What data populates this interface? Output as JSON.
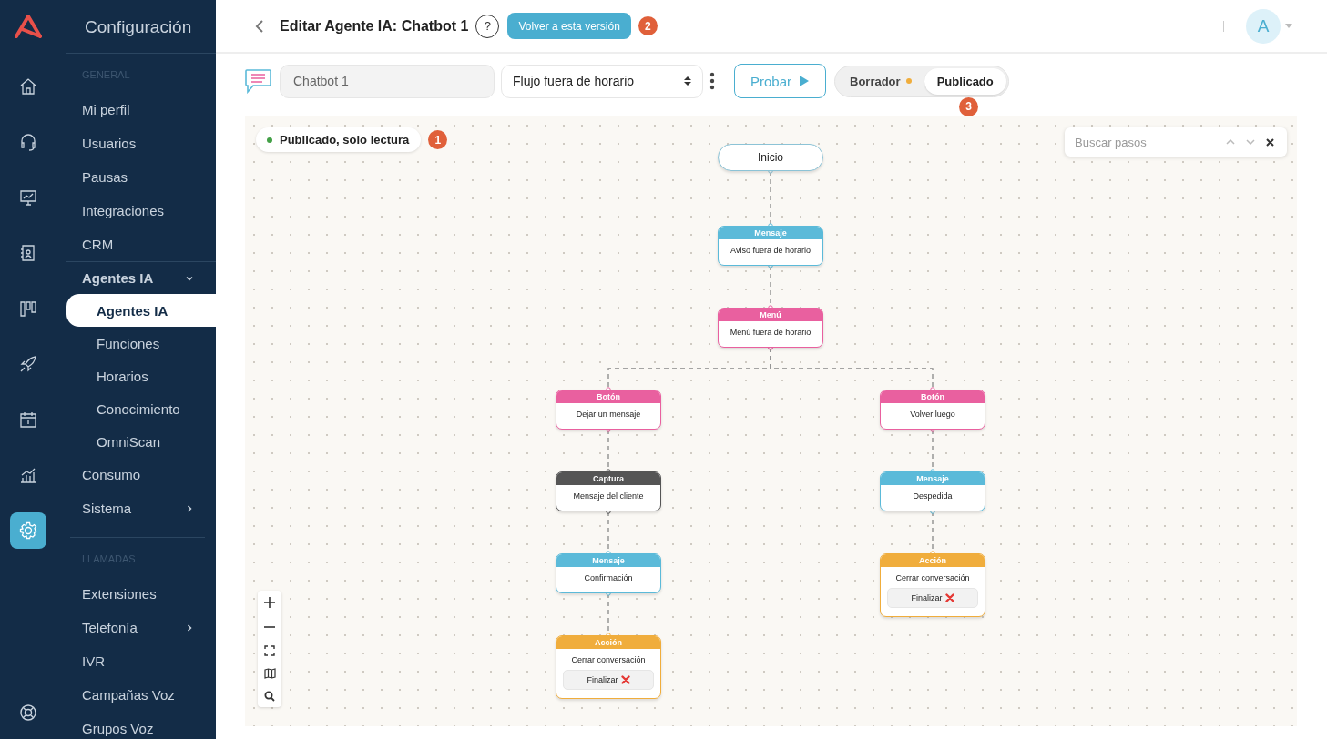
{
  "rail": [
    {
      "kind": "home",
      "selected": false
    },
    {
      "kind": "headset",
      "selected": false
    },
    {
      "kind": "monitor",
      "selected": false
    },
    {
      "kind": "contacts",
      "selected": false
    },
    {
      "kind": "board",
      "selected": false
    },
    {
      "kind": "rocket",
      "selected": false
    },
    {
      "kind": "calendar",
      "selected": false
    },
    {
      "kind": "chart",
      "selected": false
    },
    {
      "kind": "settings",
      "selected": true
    }
  ],
  "sidebar": {
    "title": "Configuración",
    "sections": [
      {
        "heading": "GENERAL",
        "items": [
          {
            "label": "Mi perfil",
            "selected": false
          },
          {
            "label": "Usuarios",
            "selected": false
          },
          {
            "label": "Pausas",
            "selected": false
          },
          {
            "label": "Integraciones",
            "selected": false
          },
          {
            "label": "CRM",
            "selected": false
          },
          {
            "label": "Agentes IA",
            "selected": false,
            "expanded": true,
            "children": [
              {
                "label": "Agentes IA",
                "selected": true
              },
              {
                "label": "Funciones",
                "selected": false
              },
              {
                "label": "Horarios",
                "selected": false
              },
              {
                "label": "Conocimiento",
                "selected": false
              },
              {
                "label": "OmniScan",
                "selected": false
              }
            ]
          },
          {
            "label": "Consumo",
            "selected": false
          },
          {
            "label": "Sistema",
            "selected": false,
            "expanded": false
          }
        ]
      },
      {
        "heading": "LLAMADAS",
        "items": [
          {
            "label": "Extensiones",
            "selected": false
          },
          {
            "label": "Telefonía",
            "selected": false,
            "expanded": false
          },
          {
            "label": "IVR",
            "selected": false
          },
          {
            "label": "Campañas Voz",
            "selected": false
          },
          {
            "label": "Grupos Voz",
            "selected": false
          }
        ]
      }
    ]
  },
  "header": {
    "title": "Editar Agente IA: Chatbot 1",
    "help": "?",
    "revert_button": "Volver a esta versión",
    "revert_badge": "2",
    "avatar": "A"
  },
  "toolbar": {
    "name_value": "Chatbot 1",
    "flow_select": "Flujo fuera de horario",
    "test_button": "Probar",
    "versions": [
      {
        "label": "Borrador",
        "selected": false,
        "changes_dot": true
      },
      {
        "label": "Publicado",
        "selected": true,
        "changes_dot": false
      }
    ],
    "versions_badge": "3"
  },
  "canvas": {
    "status": {
      "label": "Publicado, solo lectura",
      "color": "#43a047"
    },
    "status_badge": "1",
    "search": {
      "placeholder": "Buscar pasos"
    },
    "flow": {
      "kind": "start",
      "text": "Inicio",
      "children": [
        {
          "kind": "message",
          "header": "Mensaje",
          "text": "Aviso fuera de horario",
          "children": [
            {
              "kind": "menu",
              "header": "Menú",
              "text": "Menú fuera de horario",
              "children": [
                {
                  "kind": "button",
                  "header": "Botón",
                  "text": "Dejar un mensaje",
                  "children": [
                    {
                      "kind": "capture",
                      "header": "Captura",
                      "text": "Mensaje del cliente",
                      "children": [
                        {
                          "kind": "message",
                          "header": "Mensaje",
                          "text": "Confirmación",
                          "children": [
                            {
                              "kind": "action",
                              "header": "Acción",
                              "text": "Cerrar conversación",
                              "button": "Finalizar"
                            }
                          ]
                        }
                      ]
                    }
                  ]
                },
                {
                  "kind": "button",
                  "header": "Botón",
                  "text": "Volver luego",
                  "children": [
                    {
                      "kind": "message",
                      "header": "Mensaje",
                      "text": "Despedida",
                      "children": [
                        {
                          "kind": "action",
                          "header": "Acción",
                          "text": "Cerrar conversación",
                          "button": "Finalizar"
                        }
                      ]
                    }
                  ]
                }
              ]
            }
          ]
        }
      ]
    }
  }
}
